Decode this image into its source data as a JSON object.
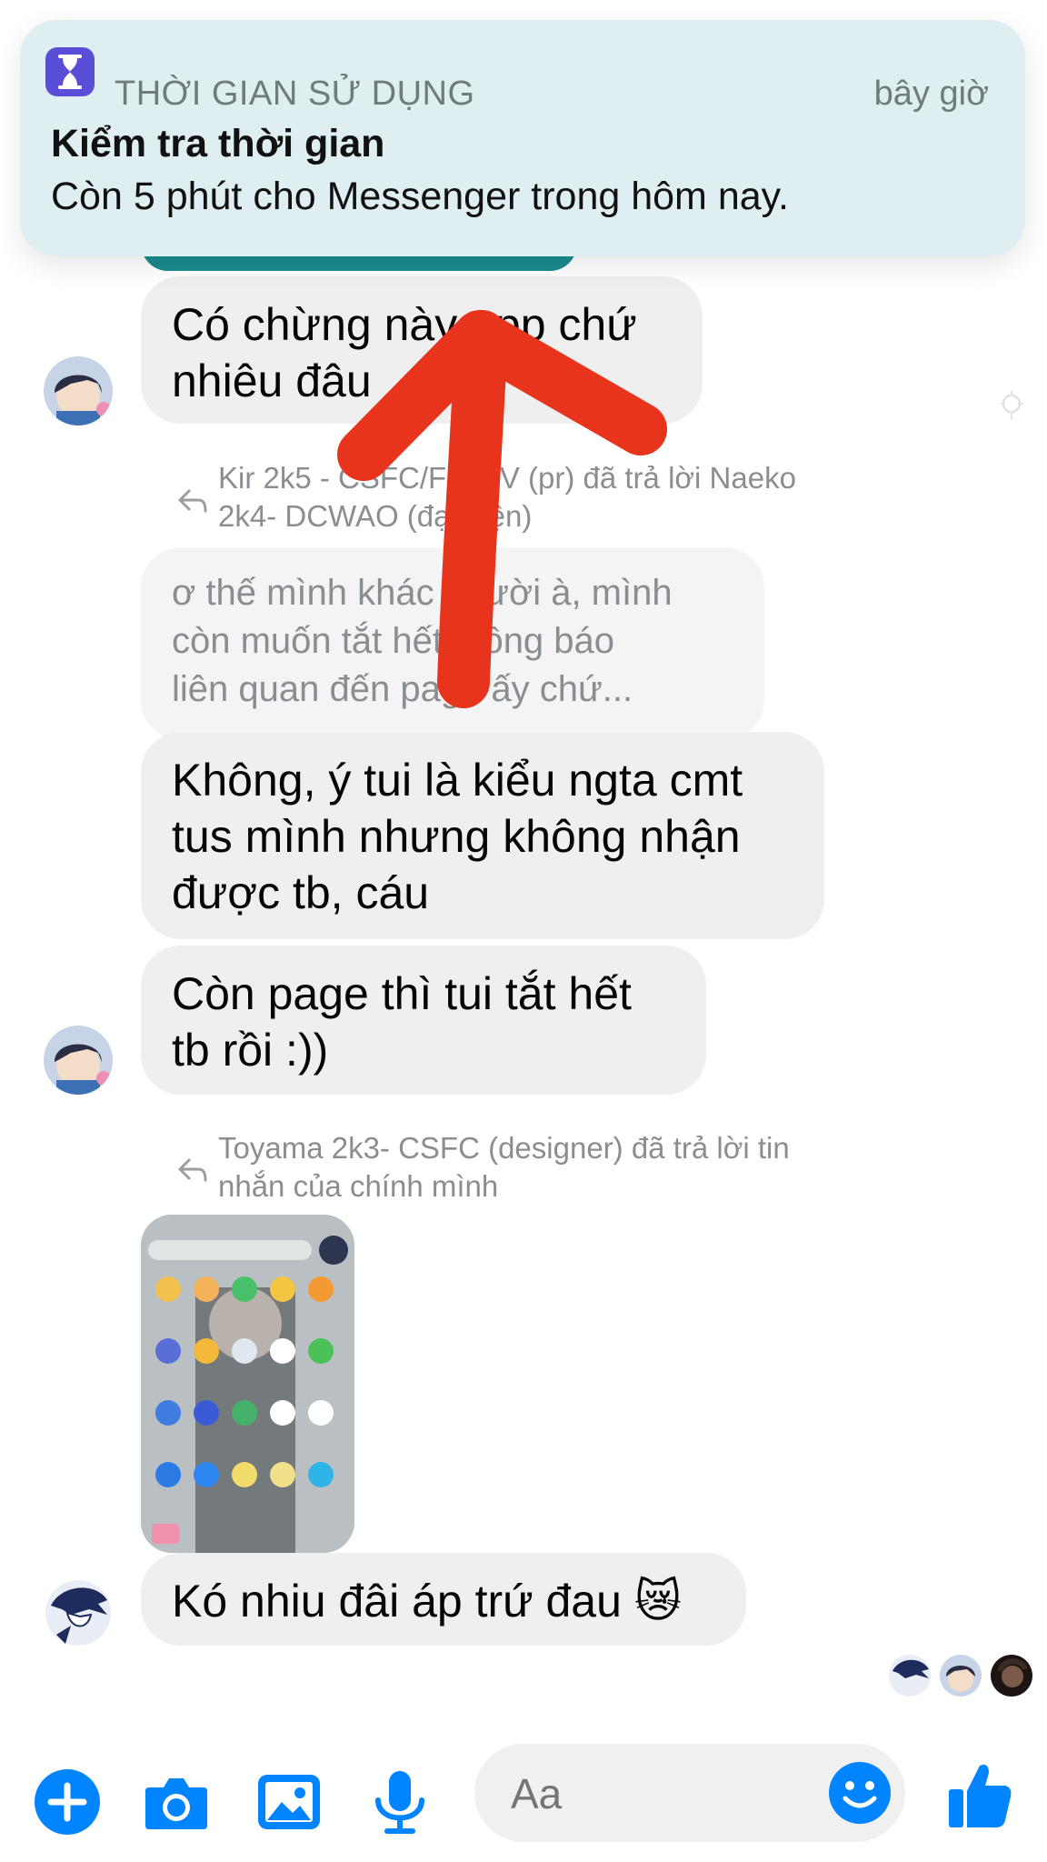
{
  "notification": {
    "app_name": "THỜI GIAN SỬ DỤNG",
    "time": "bây giờ",
    "title": "Kiểm tra thời gian",
    "body": "Còn 5 phút cho Messenger trong hôm nay.",
    "icon": "hourglass-icon"
  },
  "messages": [
    {
      "text": "Có chừng này app chứ\nnhiêu đâu"
    },
    {
      "reply_note": "Kir 2k5 - CSFC/F-DCV (pr) đã trả lời Naeko\n2k4- DCWAO (đại diện)"
    },
    {
      "quoted": "ơ thế mình khác người à, mình\ncòn muốn tắt hết thông báo\nliên quan đến page ấy chứ..."
    },
    {
      "text": "Không, ý tui là kiểu ngta cmt\ntus mình nhưng không nhận\nđược tb, cáu"
    },
    {
      "text": "Còn page thì tui tắt hết\ntb rồi :))"
    },
    {
      "reply_note": "Toyama 2k3- CSFC (designer) đã trả lời tin\nnhắn của chính mình"
    },
    {
      "text": "Kó nhiu đâi áp trứ đau 😿"
    }
  ],
  "composer": {
    "placeholder": "Aa",
    "icons": [
      "plus-icon",
      "camera-icon",
      "gallery-icon",
      "microphone-icon",
      "emoji-icon",
      "thumbs-up-icon"
    ]
  },
  "colors": {
    "accent": "#0084ff",
    "annotation_arrow": "#e8341c",
    "bubble": "#efeff0",
    "notification_bg": "#dfeff1"
  }
}
